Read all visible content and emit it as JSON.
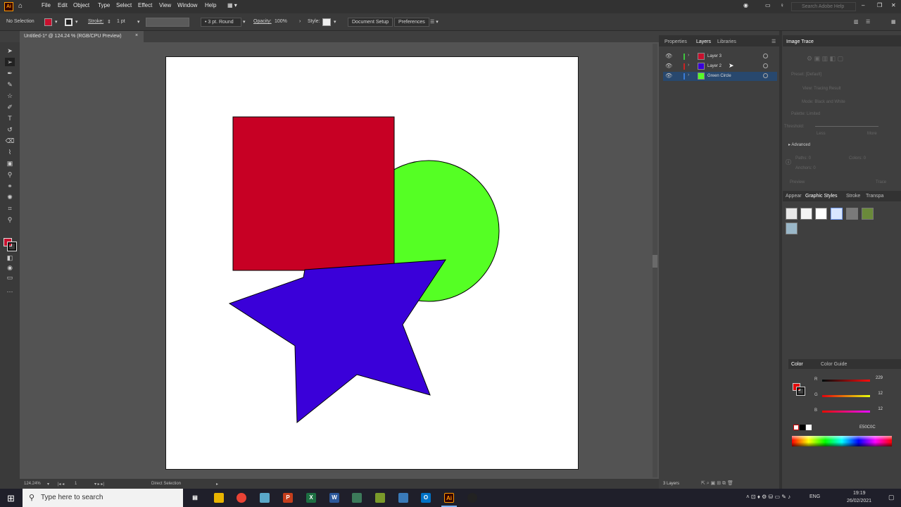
{
  "menubar": {
    "app_logo": "Ai",
    "items": [
      "File",
      "Edit",
      "Object",
      "Type",
      "Select",
      "Effect",
      "View",
      "Window",
      "Help"
    ],
    "search_placeholder": "Search Adobe Help"
  },
  "controlbar": {
    "selection": "No Selection",
    "stroke_label": "Stroke:",
    "stroke_weight": "1 pt",
    "brush": "3 pt. Round",
    "opacity_label": "Opacity:",
    "opacity_value": "100%",
    "style_label": "Style:",
    "document_setup": "Document Setup",
    "preferences": "Preferences",
    "fill_color": "#c8102e"
  },
  "document": {
    "tab_title": "Untitled-1* @ 124.24 % (RGB/CPU Preview)",
    "close": "×"
  },
  "artwork": {
    "square_color": "#c70024",
    "circle_color": "#55ff24",
    "star_color": "#3a00d9"
  },
  "panels": {
    "tabs": [
      "Properties",
      "Layers",
      "Libraries"
    ],
    "active_tab": "Layers",
    "image_trace_title": "Image Trace",
    "layers": [
      {
        "name": "Layer 3",
        "color": "#c8102e",
        "bar": "#3ec43e"
      },
      {
        "name": "Layer 2",
        "color": "#3a00d9",
        "bar": "#cc2222"
      },
      {
        "name": "Green Circle",
        "color": "#55ff24",
        "bar": "#3a7bd5"
      }
    ],
    "layers_count": "3 Layers",
    "trace": {
      "preset": "Preset: [Default]",
      "view": "View: Tracing Result",
      "mode": "Mode: Black and White",
      "palette": "Palette: Limited",
      "threshold": "Threshold:",
      "less": "Less",
      "more": "More",
      "advanced": "Advanced",
      "paths": "Paths: 0",
      "anchors": "Anchors: 0",
      "colors": "Colors: 0",
      "preview": "Preview",
      "trace_btn": "Trace"
    },
    "lower_tabs": [
      "Appear",
      "Graphic Styles",
      "Stroke",
      "Transpa"
    ],
    "lower_active": "Graphic Styles",
    "color_tabs": [
      "Color",
      "Color Guide"
    ],
    "color": {
      "r_label": "R",
      "r_value": "229",
      "g_label": "G",
      "g_value": "12",
      "b_label": "B",
      "b_value": "12",
      "hex": "E50C0C"
    }
  },
  "statusbar": {
    "zoom": "124.24%",
    "page": "1",
    "tool": "Direct Selection"
  },
  "taskbar": {
    "search_placeholder": "Type here to search",
    "lang": "ENG",
    "time": "19:19",
    "date": "26/02/2021"
  }
}
